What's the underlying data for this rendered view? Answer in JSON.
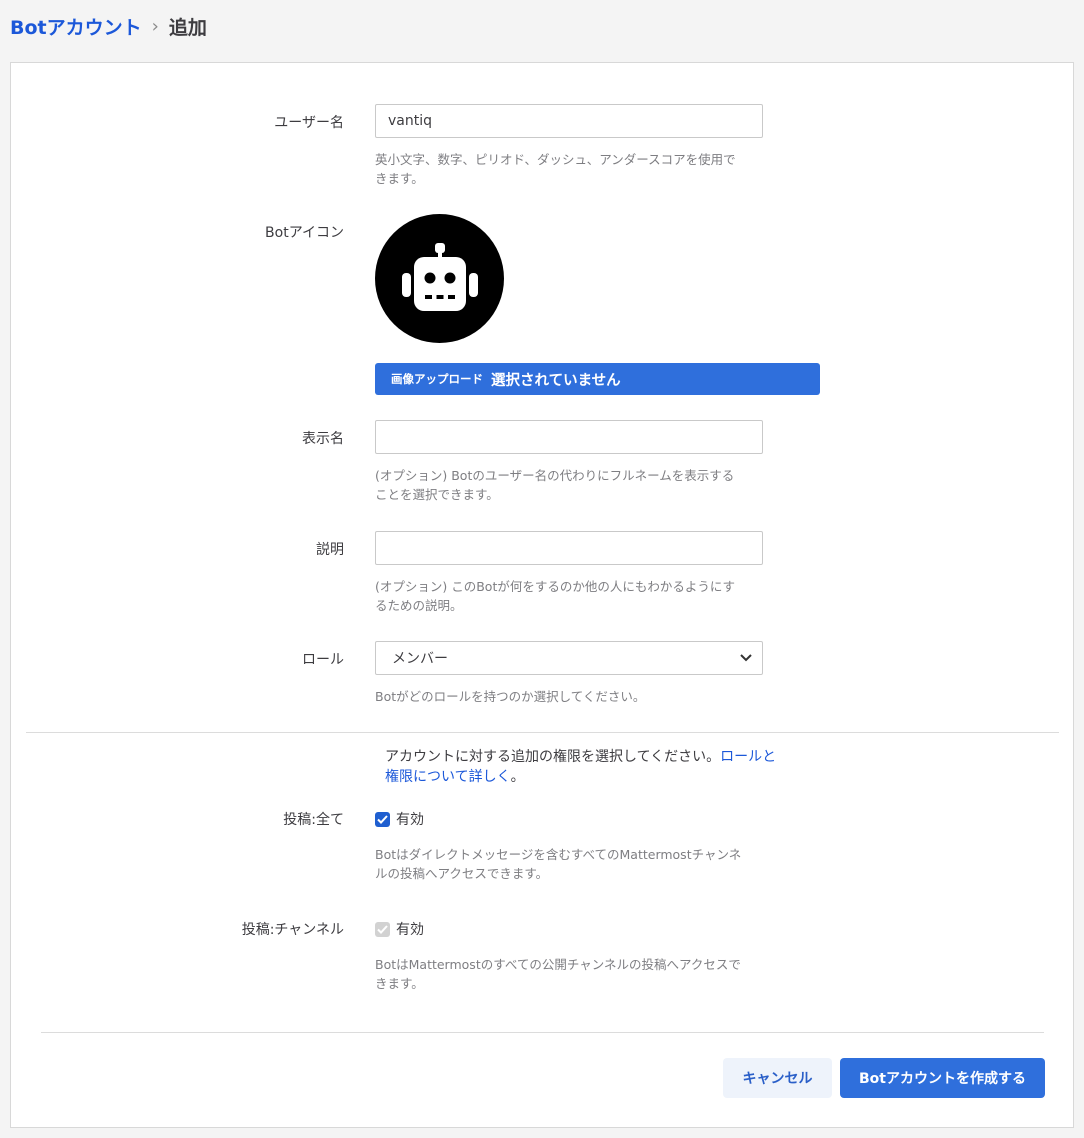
{
  "breadcrumb": {
    "parent": "Botアカウント",
    "separator": "›",
    "current": "追加"
  },
  "form": {
    "username": {
      "label": "ユーザー名",
      "value": "vantiq",
      "help_line1": "英小文字、数字、ピリオド、ダッシュ、アンダースコアを使用で",
      "help_line2": "きます。"
    },
    "bot_icon": {
      "label": "Botアイコン",
      "icon": "robot-icon",
      "upload_label": "画像アップロード",
      "upload_status": "選択されていません"
    },
    "display_name": {
      "label": "表示名",
      "value": "",
      "help_line1": "(オプション) Botのユーザー名の代わりにフルネームを表示する",
      "help_line2": "ことを選択できます。"
    },
    "description": {
      "label": "説明",
      "value": "",
      "help_line1": "(オプション) このBotが何をするのか他の人にもわかるようにす",
      "help_line2": "るための説明。"
    },
    "role": {
      "label": "ロール",
      "selected": "メンバー",
      "help": "Botがどのロールを持つのか選択してください。"
    }
  },
  "permissions": {
    "intro_text1": "アカウントに対する追加の権限を選択してください。",
    "intro_link1": "ロールと",
    "intro_link2": "権限について詳しく",
    "intro_end": "。",
    "post_all": {
      "label": "投稿:全て",
      "checkbox_label": "有効",
      "checked": true,
      "help_line1": "Botはダイレクトメッセージを含むすべてのMattermostチャンネ",
      "help_line2": "ルの投稿へアクセスできます。"
    },
    "post_channels": {
      "label": "投稿:チャンネル",
      "checkbox_label": "有効",
      "checked": true,
      "disabled": true,
      "help_line1": "BotはMattermostのすべての公開チャンネルの投稿へアクセスで",
      "help_line2": "きます。"
    }
  },
  "actions": {
    "cancel": "キャンセル",
    "create": "Botアカウントを作成する"
  },
  "colors": {
    "accent": "#2f6fdc",
    "link": "#1c58d9"
  }
}
